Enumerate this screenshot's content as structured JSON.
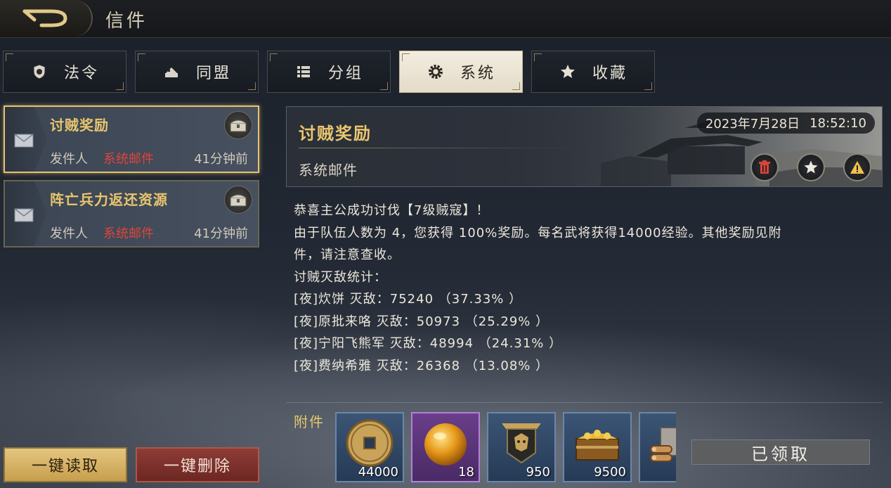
{
  "window": {
    "title": "信件"
  },
  "tabs": [
    {
      "label": "法令",
      "icon": "shield-icon",
      "active": false
    },
    {
      "label": "同盟",
      "icon": "alliance-icon",
      "active": false
    },
    {
      "label": "分组",
      "icon": "list-icon",
      "active": false
    },
    {
      "label": "系统",
      "icon": "gear-icon",
      "active": true
    },
    {
      "label": "收藏",
      "icon": "star-icon",
      "active": false
    }
  ],
  "mail_list": [
    {
      "title": "讨贼奖励",
      "sender_label": "发件人",
      "sender": "系统邮件",
      "time": "41分钟前",
      "selected": true
    },
    {
      "title": "阵亡兵力返还资源",
      "sender_label": "发件人",
      "sender": "系统邮件",
      "time": "41分钟前",
      "selected": false
    }
  ],
  "actions": {
    "read_all": "一键读取",
    "delete_all": "一键删除"
  },
  "mail": {
    "title": "讨贼奖励",
    "sender": "系统邮件",
    "date": "2023年7月28日",
    "time": "18:52:10",
    "body": [
      "恭喜主公成功讨伐【7级贼寇】！",
      "由于队伍人数为 4，您获得 100%奖励。每名武将获得14000经验。其他奖励见附",
      "件，请注意查收。",
      "讨贼灭敌统计：",
      "[夜]炊饼  灭敌：75240  （37.33% ）",
      "[夜]原批来咯  灭敌：50973  （25.29% ）",
      "[夜]宁阳飞熊军  灭敌：48994  （24.31% ）",
      "[夜]费纳希雅  灭敌：26368  （13.08% ）"
    ]
  },
  "attachments": {
    "label": "附件",
    "items": [
      {
        "icon": "coin-icon",
        "count": "44000"
      },
      {
        "icon": "orb-icon",
        "count": "18"
      },
      {
        "icon": "banner-icon",
        "count": "950"
      },
      {
        "icon": "gold-chest-icon",
        "count": "9500"
      },
      {
        "icon": "wood-icon",
        "count": ""
      }
    ],
    "claim_label": "已领取"
  },
  "colors": {
    "accent_gold": "#e9c66e",
    "sender_red": "#e0443c",
    "selected_border": "#e6c372"
  }
}
